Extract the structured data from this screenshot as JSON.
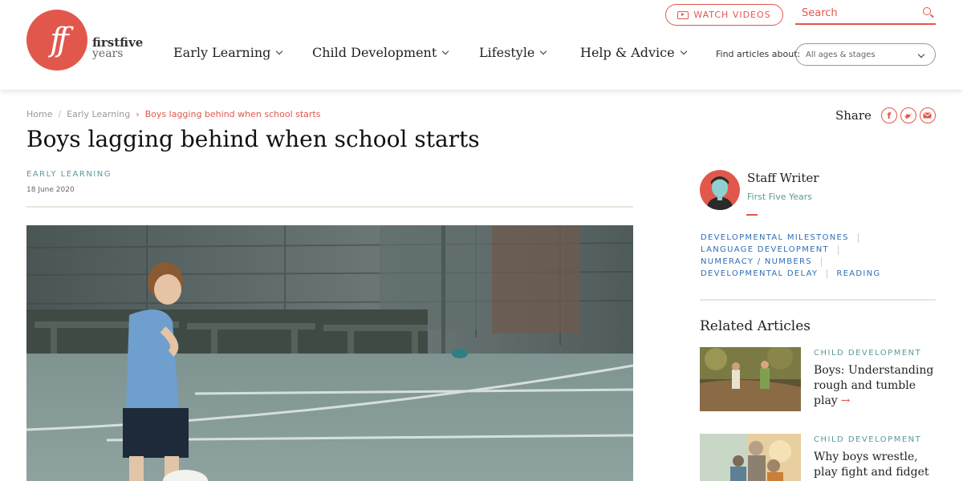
{
  "brand": {
    "logo_mark": "ff",
    "name_line1": "firstfive",
    "name_line2": "years",
    "accent_color": "#e2574c"
  },
  "nav": {
    "items": [
      {
        "label": "Early Learning"
      },
      {
        "label": "Child Development"
      },
      {
        "label": "Lifestyle"
      },
      {
        "label": "Help & Advice"
      }
    ]
  },
  "header": {
    "watch_videos_label": "WATCH VIDEOS",
    "search_placeholder": "Search",
    "find_label": "Find articles about:",
    "age_select_value": "All ages & stages"
  },
  "breadcrumb": {
    "home": "Home",
    "section": "Early Learning",
    "current": "Boys lagging behind when school starts"
  },
  "article": {
    "title": "Boys lagging behind when school starts",
    "category": "EARLY LEARNING",
    "date": "18 June 2020"
  },
  "share": {
    "label": "Share",
    "icons": [
      "facebook-icon",
      "twitter-icon",
      "email-icon"
    ]
  },
  "author": {
    "name": "Staff Writer",
    "org": "First Five Years"
  },
  "tags": [
    {
      "label": "DEVELOPMENTAL MILESTONES"
    },
    {
      "label": "LANGUAGE DEVELOPMENT"
    },
    {
      "label": "NUMERACY / NUMBERS"
    },
    {
      "label": "DEVELOPMENTAL DELAY"
    },
    {
      "label": "READING"
    }
  ],
  "related": {
    "heading": "Related Articles",
    "items": [
      {
        "category": "CHILD DEVELOPMENT",
        "title": "Boys: Understanding rough and tumble play"
      },
      {
        "category": "CHILD DEVELOPMENT",
        "title": "Why boys wrestle, play fight and fidget"
      }
    ]
  }
}
